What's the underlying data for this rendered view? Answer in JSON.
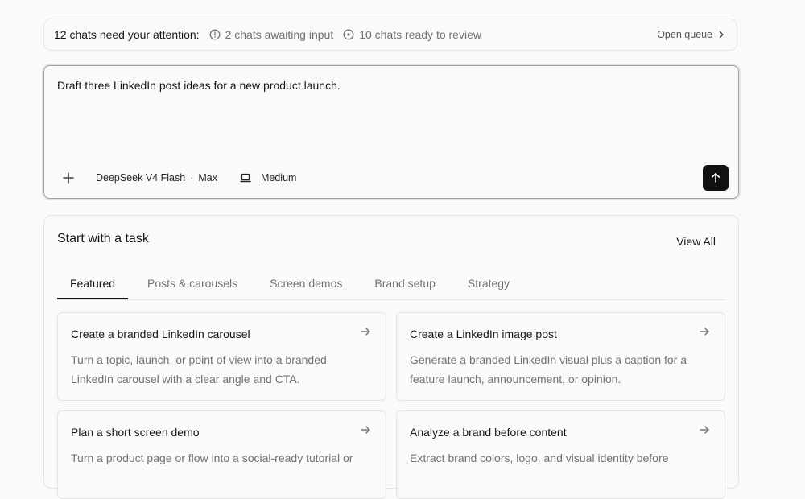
{
  "attention_bar": {
    "headline": "12 chats need your attention:",
    "awaiting": "2 chats awaiting input",
    "ready": "10 chats ready to review",
    "open_queue": "Open queue",
    "icons": [
      "info-circle-icon",
      "check-circle-icon",
      "chevron-right-icon"
    ]
  },
  "composer": {
    "prompt": "Draft three LinkedIn post ideas for a new product launch.",
    "model": "DeepSeek V4 Flash",
    "model_separator": "·",
    "model_mode": "Max",
    "effort": "Medium",
    "icons": [
      "plus-icon",
      "laptop-icon",
      "arrow-up-icon"
    ]
  },
  "tasks": {
    "title": "Start with a task",
    "view_all": "View All",
    "tabs": [
      {
        "label": "Featured",
        "active": true
      },
      {
        "label": "Posts & carousels",
        "active": false
      },
      {
        "label": "Screen demos",
        "active": false
      },
      {
        "label": "Brand setup",
        "active": false
      },
      {
        "label": "Strategy",
        "active": false
      }
    ],
    "cards": [
      {
        "title": "Create a branded LinkedIn carousel",
        "description": "Turn a topic, launch, or point of view into a branded LinkedIn carousel with a clear angle and CTA."
      },
      {
        "title": "Create a LinkedIn image post",
        "description": "Generate a branded LinkedIn visual plus a caption for a feature launch, announcement, or opinion."
      },
      {
        "title": "Plan a short screen demo",
        "description": "Turn a product page or flow into a social-ready tutorial or"
      },
      {
        "title": "Analyze a brand before content",
        "description": "Extract brand colors, logo, and visual identity before"
      }
    ]
  },
  "colors": {
    "background": "#fafafa",
    "text_primary": "#18181b",
    "text_muted": "#71717a",
    "border": "#e4e4e7",
    "send_button": "#111113"
  }
}
